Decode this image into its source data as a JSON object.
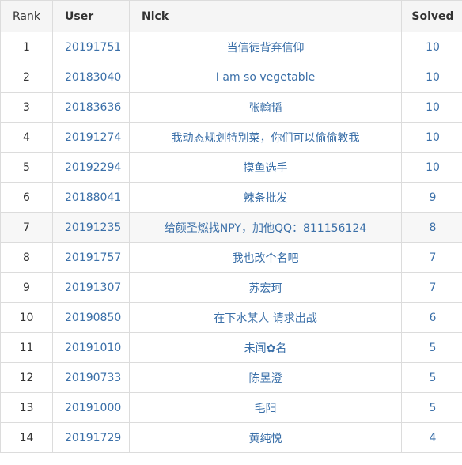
{
  "table": {
    "headers": {
      "rank": "Rank",
      "user": "User",
      "nick": "Nick",
      "solved": "Solved"
    },
    "rows": [
      {
        "rank": "1",
        "user": "20191751",
        "nick": "当信徒背弃信仰",
        "solved": "10"
      },
      {
        "rank": "2",
        "user": "20183040",
        "nick": "I am so vegetable",
        "solved": "10"
      },
      {
        "rank": "3",
        "user": "20183636",
        "nick": "张翰韬",
        "solved": "10"
      },
      {
        "rank": "4",
        "user": "20191274",
        "nick": "我动态规划特别菜，你们可以偷偷教我",
        "solved": "10"
      },
      {
        "rank": "5",
        "user": "20192294",
        "nick": "摸鱼选手",
        "solved": "10"
      },
      {
        "rank": "6",
        "user": "20188041",
        "nick": "辣条批发",
        "solved": "9"
      },
      {
        "rank": "7",
        "user": "20191235",
        "nick": "给颜圣燃找NPY，加他QQ：811156124",
        "solved": "8"
      },
      {
        "rank": "8",
        "user": "20191757",
        "nick": "我也改个名吧",
        "solved": "7"
      },
      {
        "rank": "9",
        "user": "20191307",
        "nick": "苏宏珂",
        "solved": "7"
      },
      {
        "rank": "10",
        "user": "20190850",
        "nick": "在下水某人 请求出战",
        "solved": "6"
      },
      {
        "rank": "11",
        "user": "20191010",
        "nick": "未闻✿名",
        "solved": "5"
      },
      {
        "rank": "12",
        "user": "20190733",
        "nick": "陈昱澄",
        "solved": "5"
      },
      {
        "rank": "13",
        "user": "20191000",
        "nick": "毛阳",
        "solved": "5"
      },
      {
        "rank": "14",
        "user": "20191729",
        "nick": "黄纯悦",
        "solved": "4"
      }
    ],
    "highlighted_row_rank": "7",
    "colors": {
      "link": "#3a6fa8",
      "header_bg": "#f5f5f5",
      "border": "#dcdcdc",
      "highlight_bg": "#f7f7f7"
    }
  }
}
